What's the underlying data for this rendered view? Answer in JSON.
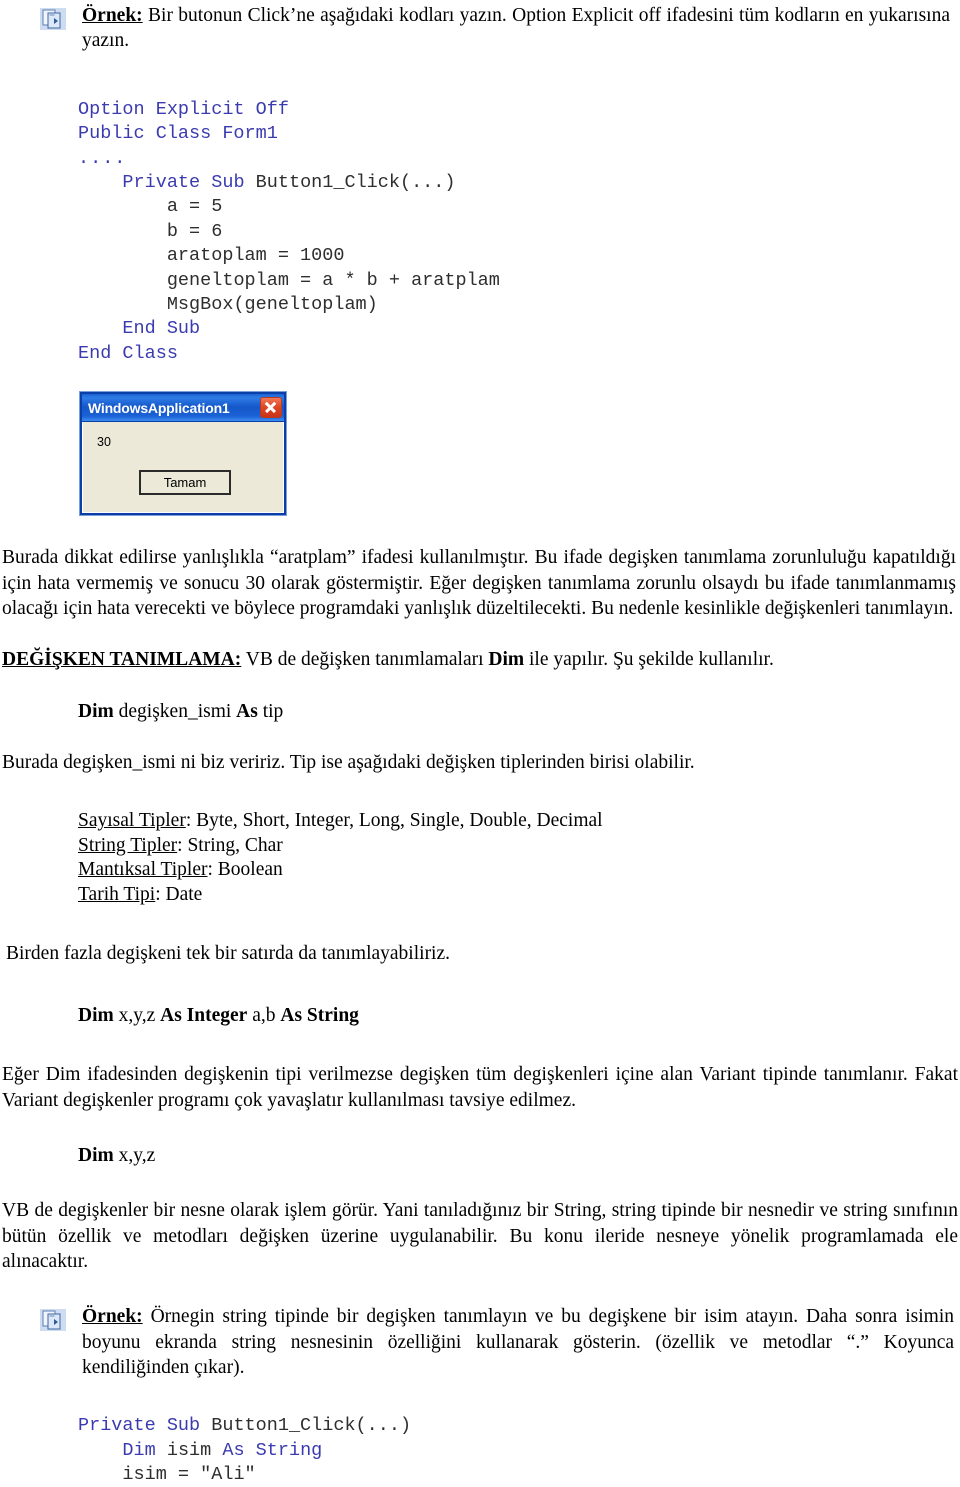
{
  "document": {
    "language": "tr",
    "icon_name": "copy-pages-icon",
    "accent_code_color": "#3b3bb0",
    "code_text_color": "#2e2e2e"
  },
  "example1": {
    "label": "Örnek:",
    "text": " Bir butonun Click’ne aşağıdaki kodları yazın. Option Explicit off ifadesini tüm kodların en yukarısına yazın."
  },
  "code1": {
    "lines": [
      {
        "indent": "",
        "keyword": "Option Explicit Off",
        "plain": ""
      },
      {
        "indent": "",
        "keyword": "Public Class Form1",
        "plain": ""
      },
      {
        "indent": "",
        "keyword": "....",
        "plain": ""
      },
      {
        "indent": "    ",
        "keyword": "Private Sub ",
        "plain": "Button1_Click(...)"
      },
      {
        "indent": "        ",
        "keyword": "",
        "plain": "a = 5"
      },
      {
        "indent": "        ",
        "keyword": "",
        "plain": "b = 6"
      },
      {
        "indent": "        ",
        "keyword": "",
        "plain": "aratoplam = 1000"
      },
      {
        "indent": "        ",
        "keyword": "",
        "plain": "geneltoplam = a * b + aratplam"
      },
      {
        "indent": "        ",
        "keyword": "",
        "plain": "MsgBox(geneltoplam)"
      },
      {
        "indent": "    ",
        "keyword": "End Sub",
        "plain": ""
      },
      {
        "indent": "",
        "keyword": "End Class",
        "plain": ""
      }
    ]
  },
  "msgbox": {
    "title": "WindowsApplication1",
    "close_label": "close-button",
    "message": "30",
    "button_label": "Tamam"
  },
  "paragraph_aratplam": {
    "text": "Burada dikkat edilirse yanlışlıkla “aratplam”  ifadesi kullanılmıştır. Bu ifade degişken tanımlama zorunluluğu kapatıldığı için hata vermemiş ve sonucu 30 olarak göstermiştir. Eğer degişken tanımlama zorunlu olsaydı bu ifade tanımlanmamış olacağı için hata verecekti ve böylece programdaki yanlışlık düzeltilecekti. Bu nedenle kesinlikle değişkenleri tanımlayın."
  },
  "heading_degisken": {
    "title": "DEĞİŞKEN TANIMLAMA:",
    "rest_1": " VB de değişken tanımlamaları ",
    "bold_dim": "Dim",
    "rest_2": " ile yapılır. Şu şekilde kullanılır."
  },
  "syntax_dim": {
    "dim": "Dim",
    "name": " degişken_ismi ",
    "as": "As",
    "type": " tip"
  },
  "paragraph_tip": {
    "text": "Burada degişken_ismi ni biz veririz. Tip ise aşağıdaki değişken tiplerinden birisi olabilir."
  },
  "type_list": [
    {
      "label": "Sayısal Tipler",
      "values": ": Byte, Short, Integer, Long, Single, Double, Decimal"
    },
    {
      "label": "String Tipler",
      "values": ": String, Char"
    },
    {
      "label": "Mantıksal Tipler",
      "values": ": Boolean"
    },
    {
      "label": "Tarih Tipi",
      "values": ": Date"
    }
  ],
  "paragraph_multi": {
    "text": "Birden fazla degişkeni tek bir satırda da tanımlayabiliriz."
  },
  "syntax_multi": {
    "dim": "Dim",
    "vars1": " x,y,z ",
    "as_integer": "As Integer",
    "vars2": " a,b  ",
    "as_string": "As String"
  },
  "paragraph_variant": {
    "text": "Eğer Dim ifadesinden degişkenin tipi verilmezse degişken tüm degişkenleri içine alan Variant tipinde tanımlanır. Fakat Variant degişkenler programı çok yavaşlatır kullanılması tavsiye edilmez."
  },
  "syntax_variant": {
    "dim": "Dim",
    "vars": " x,y,z"
  },
  "paragraph_object": {
    "text": "VB de degişkenler bir nesne olarak işlem görür. Yani tanıladığınız bir String, string tipinde bir nesnedir ve string sınıfının bütün özellik ve metodları değişken üzerine uygulanabilir. Bu konu ileride nesneye yönelik programlamada ele alınacaktır."
  },
  "example2": {
    "label": "Örnek:",
    "text": " Örnegin string tipinde bir degişken tanımlayın ve bu degişkene bir isim atayın. Daha sonra isimin boyunu ekranda string nesnesinin özelliğini kullanarak gösterin. (özellik ve metodlar “.” Koyunca kendiliğinden çıkar)."
  },
  "code2": {
    "lines": [
      {
        "indent": "",
        "keyword": "Private Sub ",
        "plain": "Button1_Click(...)"
      },
      {
        "indent": "    ",
        "keyword": "Dim ",
        "plain": "isim ",
        "keyword2": "As String"
      },
      {
        "indent": "    ",
        "keyword": "",
        "plain": "isim = \"Ali\""
      }
    ]
  }
}
